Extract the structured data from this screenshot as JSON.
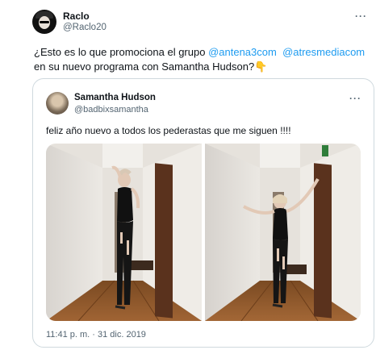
{
  "author": {
    "display_name": "Raclo",
    "handle": "@Raclo20"
  },
  "tweet": {
    "line1_prefix": "¿Esto es lo que promociona el grupo ",
    "mention1": "@antena3com",
    "mention2": "@atresmediacom",
    "line2": "en su nuevo programa con Samantha Hudson?",
    "emoji": "👇"
  },
  "quoted": {
    "display_name": "Samantha Hudson",
    "handle": "@badbixsamantha",
    "text": "feliz año nuevo a todos los pederastas que me siguen !!!!",
    "timestamp": "11:41 p. m. · 31 dic. 2019"
  },
  "icons": {
    "more": "more-icon",
    "quoted_more": "more-icon"
  },
  "colors": {
    "link": "#1d9bf0",
    "secondary_text": "#536471",
    "border": "#cfd9de"
  }
}
